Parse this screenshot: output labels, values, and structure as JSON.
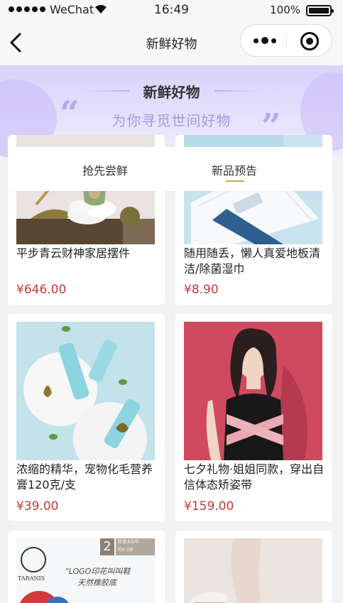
{
  "status_bar": {
    "carrier": "WeChat",
    "time": "16:49",
    "battery": "100%"
  },
  "nav": {
    "title": "新鲜好物"
  },
  "banner": {
    "title": "新鲜好物",
    "subtitle": "为你寻觅世间好物"
  },
  "tabs": [
    {
      "label": "抢先尝鲜"
    },
    {
      "label": "新品预告"
    }
  ],
  "products": [
    {
      "name": "平步青云财神家居摆件",
      "price": "¥646.00"
    },
    {
      "name": "随用随丢，懒人真爱地板清洁/除菌湿巾",
      "price": "¥8.90"
    },
    {
      "name": "浓缩的精华，宠物化毛营养膏120克/支",
      "price": "¥39.00"
    },
    {
      "name": "七夕礼物·姐姐同款，穿出自信体态矫姿带",
      "price": "¥159.00"
    },
    {
      "name": "",
      "price": ""
    },
    {
      "name": "",
      "price": ""
    }
  ],
  "product_images": {
    "p5_badge_number": "2",
    "p5_badge_text": "防滑大中华",
    "p5_badge_sub": "约0-3岁",
    "p5_brand": "TARANIS",
    "p5_tagline_1": "“LOGO印花叫叫鞋",
    "p5_tagline_2": "天然橡胶底"
  },
  "colors": {
    "accent": "#c9a94d",
    "price": "#c8393a",
    "banner": "#d9d2fb",
    "banner_subtitle": "#a39be0"
  }
}
